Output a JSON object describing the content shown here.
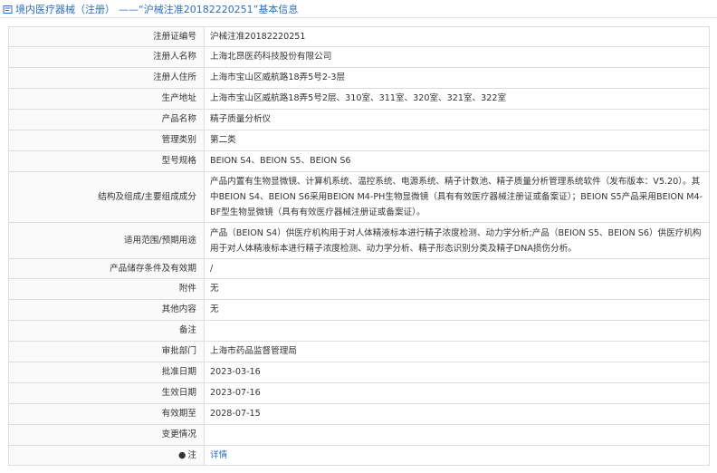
{
  "breadcrumb": {
    "part1": "境内医疗器械（注册）",
    "part2": "——“沪械注准20182220251”基本信息"
  },
  "rows": [
    {
      "label": "注册证编号",
      "value": "沪械注准20182220251"
    },
    {
      "label": "注册人名称",
      "value": "上海北昂医药科技股份有限公司"
    },
    {
      "label": "注册人住所",
      "value": "上海市宝山区威航路18弄5号2-3层"
    },
    {
      "label": "生产地址",
      "value": "上海市宝山区威航路18弄5号2层、310室、311室、320室、321室、322室"
    },
    {
      "label": "产品名称",
      "value": "精子质量分析仪"
    },
    {
      "label": "管理类别",
      "value": "第二类"
    },
    {
      "label": "型号规格",
      "value": "BEION S4、BEION S5、BEION S6"
    },
    {
      "label": "结构及组成/主要组成成分",
      "value": "产品内置有生物显微镜、计算机系统、温控系统、电源系统、精子计数池、精子质量分析管理系统软件（发布版本：V5.20）。其中BEION S4、BEION S6采用BEION M4-PH生物显微镜（具有有效医疗器械注册证或备案证）；BEION S5产品采用BEION M4-BF型生物显微镜（具有有效医疗器械注册证或备案证）。"
    },
    {
      "label": "适用范围/预期用途",
      "value": "产品（BEION S4）供医疗机构用于对人体精液标本进行精子浓度检测、动力学分析;产品（BEION S5、BEION S6）供医疗机构用于对人体精液标本进行精子浓度检测、动力学分析、精子形态识别分类及精子DNA损伤分析。"
    },
    {
      "label": "产品储存条件及有效期",
      "value": "/"
    },
    {
      "label": "附件",
      "value": "无"
    },
    {
      "label": "其他内容",
      "value": "无"
    },
    {
      "label": "备注",
      "value": ""
    },
    {
      "label": "审批部门",
      "value": "上海市药品监督管理局"
    },
    {
      "label": "批准日期",
      "value": "2023-03-16"
    },
    {
      "label": "生效日期",
      "value": "2023-07-16"
    },
    {
      "label": "有效期至",
      "value": "2028-07-15"
    },
    {
      "label": "变更情况",
      "value": ""
    },
    {
      "label": "注",
      "value": "详情"
    }
  ]
}
